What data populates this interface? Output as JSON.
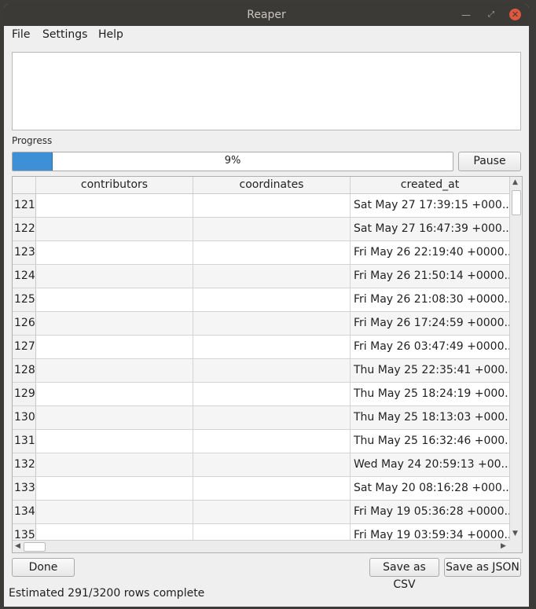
{
  "window": {
    "title": "Reaper"
  },
  "menu": [
    "File",
    "Settings",
    "Help"
  ],
  "progress": {
    "label": "Progress",
    "value": 9,
    "text": "9%"
  },
  "buttons": {
    "pause": "Pause",
    "done": "Done",
    "save_csv": "Save as CSV",
    "save_json": "Save as JSON"
  },
  "table": {
    "columns": [
      "contributors",
      "coordinates",
      "created_at"
    ],
    "rows": [
      {
        "num": "121",
        "contributors": "",
        "coordinates": "",
        "created_at": "Sat May 27 17:39:15 +000..."
      },
      {
        "num": "122",
        "contributors": "",
        "coordinates": "",
        "created_at": "Sat May 27 16:47:39 +000..."
      },
      {
        "num": "123",
        "contributors": "",
        "coordinates": "",
        "created_at": "Fri May 26 22:19:40 +0000..."
      },
      {
        "num": "124",
        "contributors": "",
        "coordinates": "",
        "created_at": "Fri May 26 21:50:14 +0000..."
      },
      {
        "num": "125",
        "contributors": "",
        "coordinates": "",
        "created_at": "Fri May 26 21:08:30 +0000..."
      },
      {
        "num": "126",
        "contributors": "",
        "coordinates": "",
        "created_at": "Fri May 26 17:24:59 +0000..."
      },
      {
        "num": "127",
        "contributors": "",
        "coordinates": "",
        "created_at": "Fri May 26 03:47:49 +0000..."
      },
      {
        "num": "128",
        "contributors": "",
        "coordinates": "",
        "created_at": "Thu May 25 22:35:41 +000..."
      },
      {
        "num": "129",
        "contributors": "",
        "coordinates": "",
        "created_at": "Thu May 25 18:24:19 +000..."
      },
      {
        "num": "130",
        "contributors": "",
        "coordinates": "",
        "created_at": "Thu May 25 18:13:03 +000..."
      },
      {
        "num": "131",
        "contributors": "",
        "coordinates": "",
        "created_at": "Thu May 25 16:32:46 +000..."
      },
      {
        "num": "132",
        "contributors": "",
        "coordinates": "",
        "created_at": "Wed May 24 20:59:13 +00..."
      },
      {
        "num": "133",
        "contributors": "",
        "coordinates": "",
        "created_at": "Sat May 20 08:16:28 +000..."
      },
      {
        "num": "134",
        "contributors": "",
        "coordinates": "",
        "created_at": "Fri May 19 05:36:28 +0000..."
      },
      {
        "num": "135",
        "contributors": "",
        "coordinates": "",
        "created_at": "Fri May 19 03:59:34 +0000..."
      }
    ]
  },
  "status": "Estimated 291/3200 rows complete",
  "icons": {
    "minimize": "minimize-icon",
    "maximize": "maximize-icon",
    "close": "close-icon"
  },
  "colors": {
    "accent": "#3d8fd6",
    "close": "#e0573e",
    "titlebar": "#3b3a36"
  }
}
